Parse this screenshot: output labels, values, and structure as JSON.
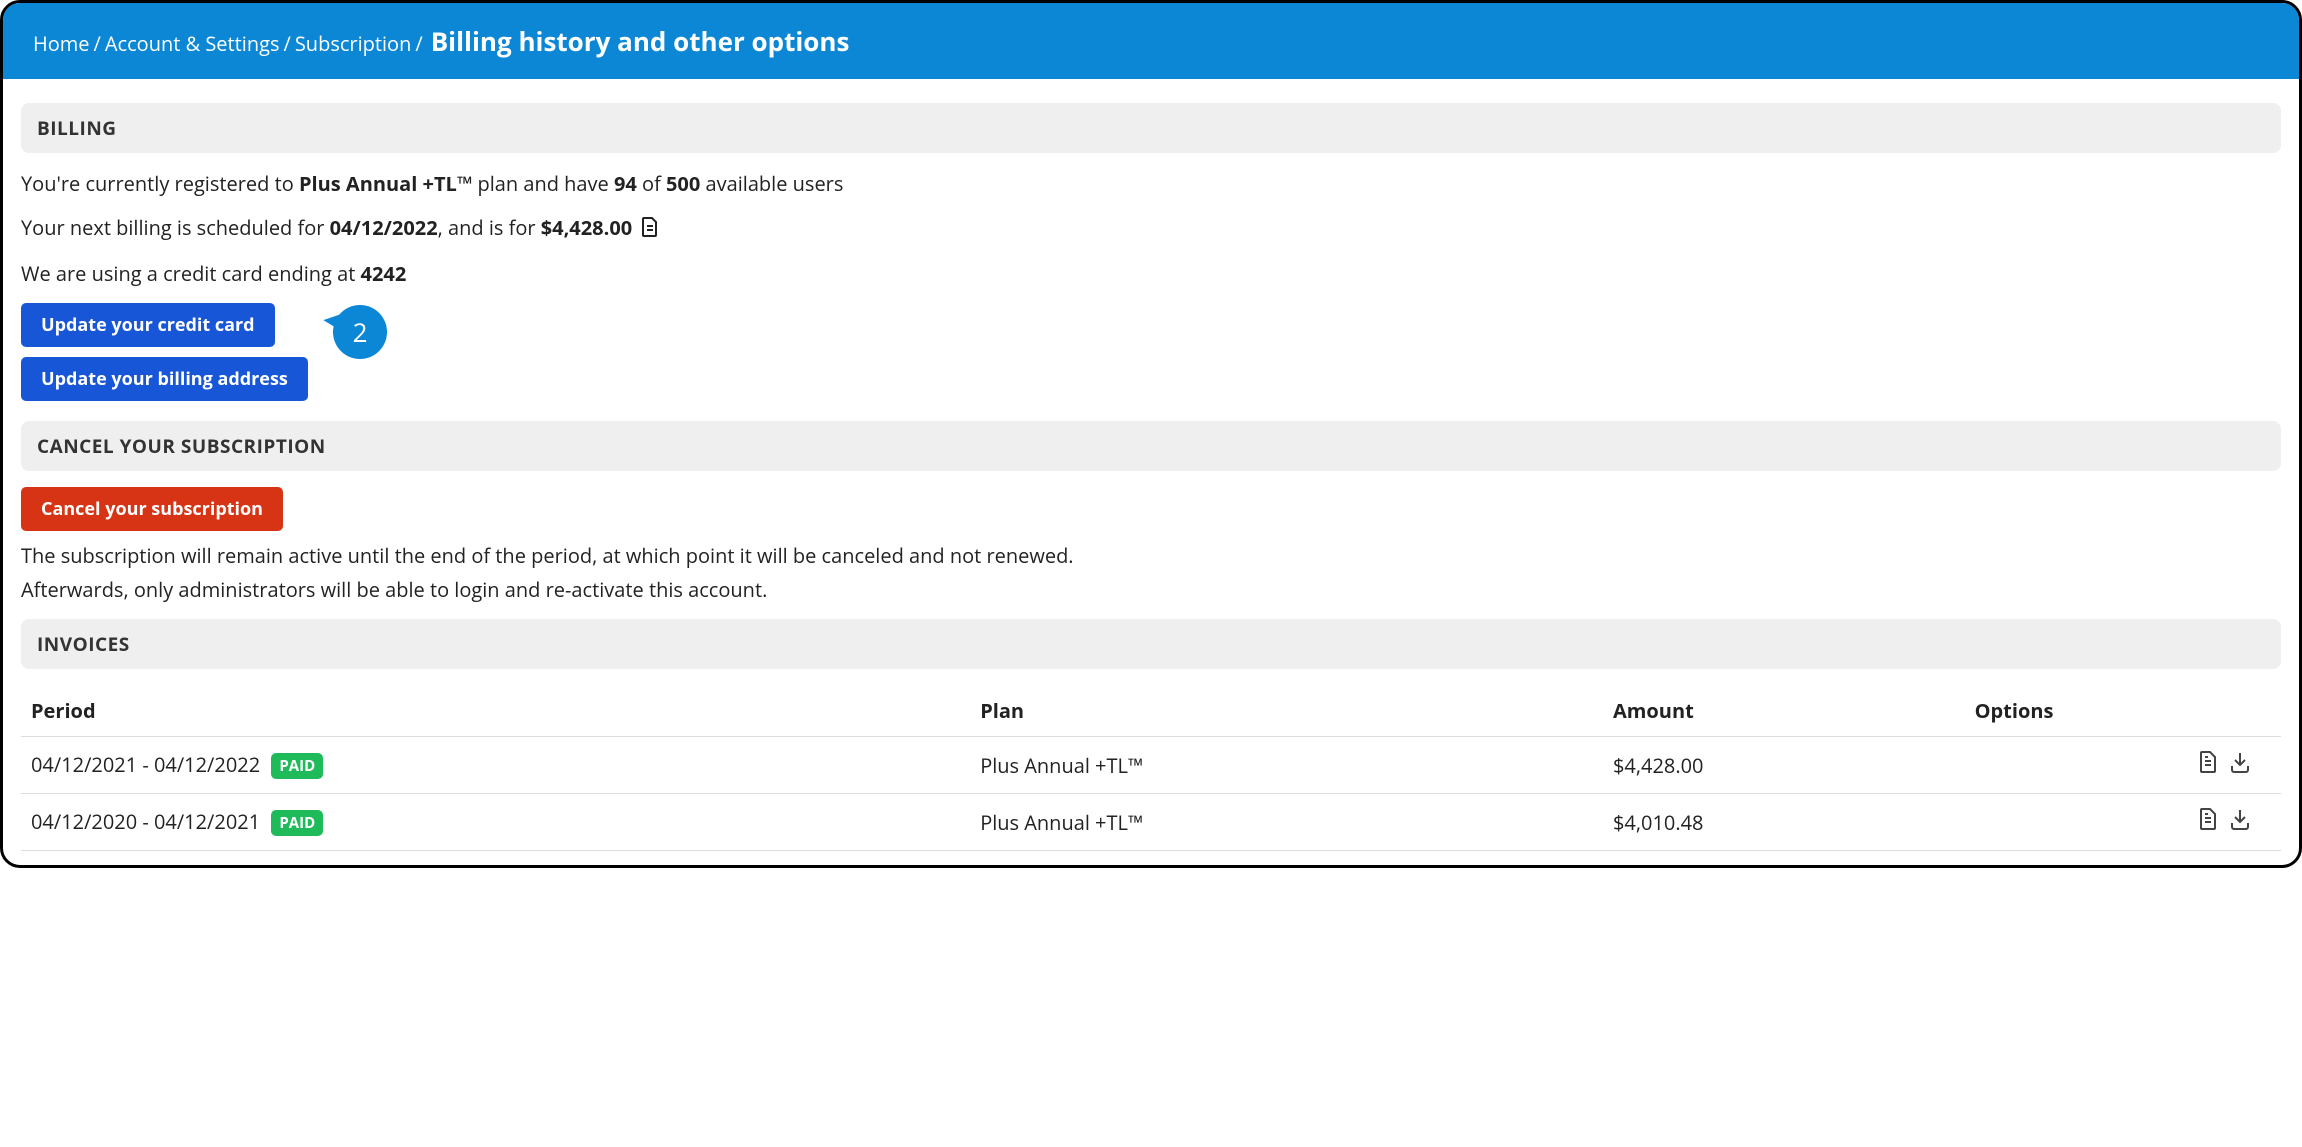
{
  "breadcrumb": {
    "links": [
      "Home",
      "Account & Settings",
      "Subscription"
    ],
    "current": "Billing history and other options"
  },
  "billing": {
    "header": "BILLING",
    "line1_a": "You're currently registered to ",
    "plan_name": "Plus Annual +TL™",
    "line1_b": " plan and have ",
    "used_users": "94",
    "line1_c": " of ",
    "total_users": "500",
    "line1_d": " available users",
    "line2_a": "Your next billing is scheduled for ",
    "next_date": "04/12/2022",
    "line2_b": ", and is for ",
    "next_amount": "$4,428.00",
    "line3_a": "We are using a credit card ending at ",
    "card_last4": "4242",
    "btn_update_card": "Update your credit card",
    "btn_update_address": "Update your billing address",
    "callout_number": "2"
  },
  "cancel": {
    "header": "CANCEL YOUR SUBSCRIPTION",
    "btn_cancel": "Cancel your subscription",
    "note1": "The subscription will remain active until the end of the period, at which point it will be canceled and not renewed.",
    "note2": "Afterwards, only administrators will be able to login and re-activate this account."
  },
  "invoices": {
    "header": "INVOICES",
    "columns": {
      "period": "Period",
      "plan": "Plan",
      "amount": "Amount",
      "options": "Options"
    },
    "rows": [
      {
        "period": "04/12/2021 - 04/12/2022",
        "status": "PAID",
        "plan": "Plus Annual +TL™",
        "amount": "$4,428.00"
      },
      {
        "period": "04/12/2020 - 04/12/2021",
        "status": "PAID",
        "plan": "Plus Annual +TL™",
        "amount": "$4,010.48"
      }
    ]
  }
}
